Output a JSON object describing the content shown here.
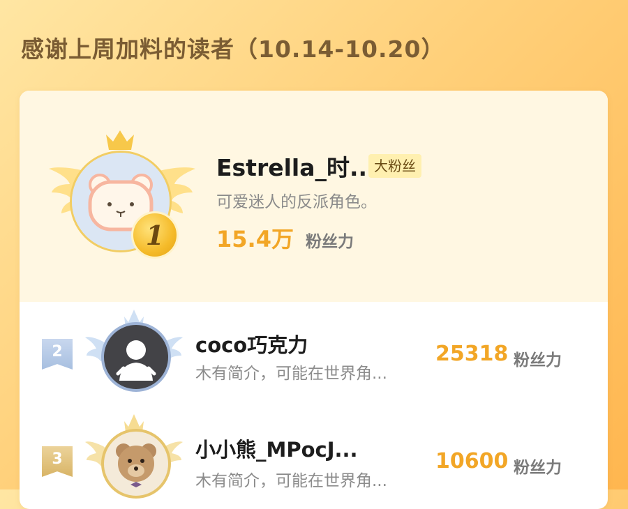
{
  "header": {
    "title": "感谢上周加料的读者（10.14-10.20）"
  },
  "colors": {
    "accent": "#f2a626",
    "badge_bg": "#fff0b0",
    "gold": "#f5bb2a"
  },
  "top_fan": {
    "rank": "1",
    "name": "Estrella_时...",
    "badge": "大粉丝",
    "bio": "可爱迷人的反派角色。",
    "score": "15.4万",
    "score_unit": "粉丝力",
    "avatar_icon": "bear-avatar-icon"
  },
  "rows": [
    {
      "rank": "2",
      "name": "coco巧克力",
      "bio": "木有简介，可能在世界角...",
      "score": "25318",
      "score_unit": "粉丝力",
      "avatar_icon": "default-person-avatar-icon"
    },
    {
      "rank": "3",
      "name": "小小熊_MPocJ...",
      "bio": "木有简介，可能在世界角...",
      "score": "10600",
      "score_unit": "粉丝力",
      "avatar_icon": "teddy-bear-avatar-icon"
    }
  ]
}
